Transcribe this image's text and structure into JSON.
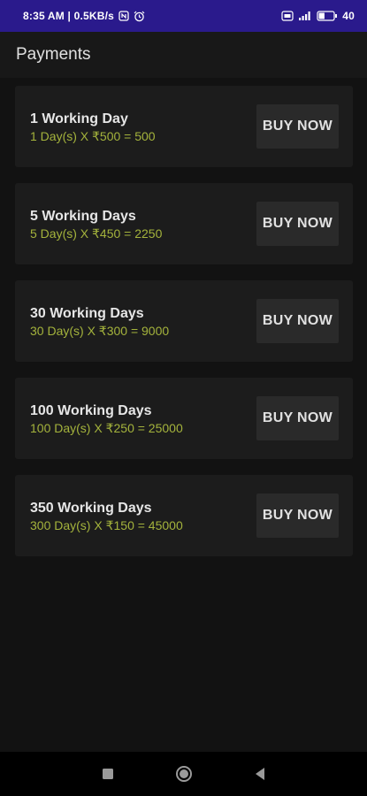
{
  "status_bar": {
    "time_network": "8:35 AM | 0.5KB/s",
    "battery_text": "40",
    "battery_percent": 40,
    "left_icons": [
      "nfc-icon",
      "alarm-icon"
    ],
    "right_icons": [
      "volte-icon",
      "signal-icon",
      "battery-icon"
    ]
  },
  "app_bar": {
    "title": "Payments"
  },
  "plans": [
    {
      "title": "1 Working Day",
      "price": "1 Day(s) X ₹500 = 500",
      "button": "BUY NOW"
    },
    {
      "title": "5 Working Days",
      "price": "5 Day(s) X ₹450 = 2250",
      "button": "BUY NOW"
    },
    {
      "title": "30 Working Days",
      "price": "30 Day(s) X ₹300 = 9000",
      "button": "BUY NOW"
    },
    {
      "title": "100 Working Days",
      "price": "100 Day(s) X ₹250 = 25000",
      "button": "BUY NOW"
    },
    {
      "title": "350 Working Days",
      "price": "300 Day(s) X ₹150 = 45000",
      "button": "BUY NOW"
    }
  ],
  "nav_bar": {
    "icons": [
      "recents-square-icon",
      "home-circle-icon",
      "back-triangle-icon"
    ]
  },
  "colors": {
    "status_bar": "#2a1a8c",
    "background": "#121212",
    "card": "#1c1c1c",
    "button": "#2a2a2a",
    "price_text": "#a4b33c"
  }
}
